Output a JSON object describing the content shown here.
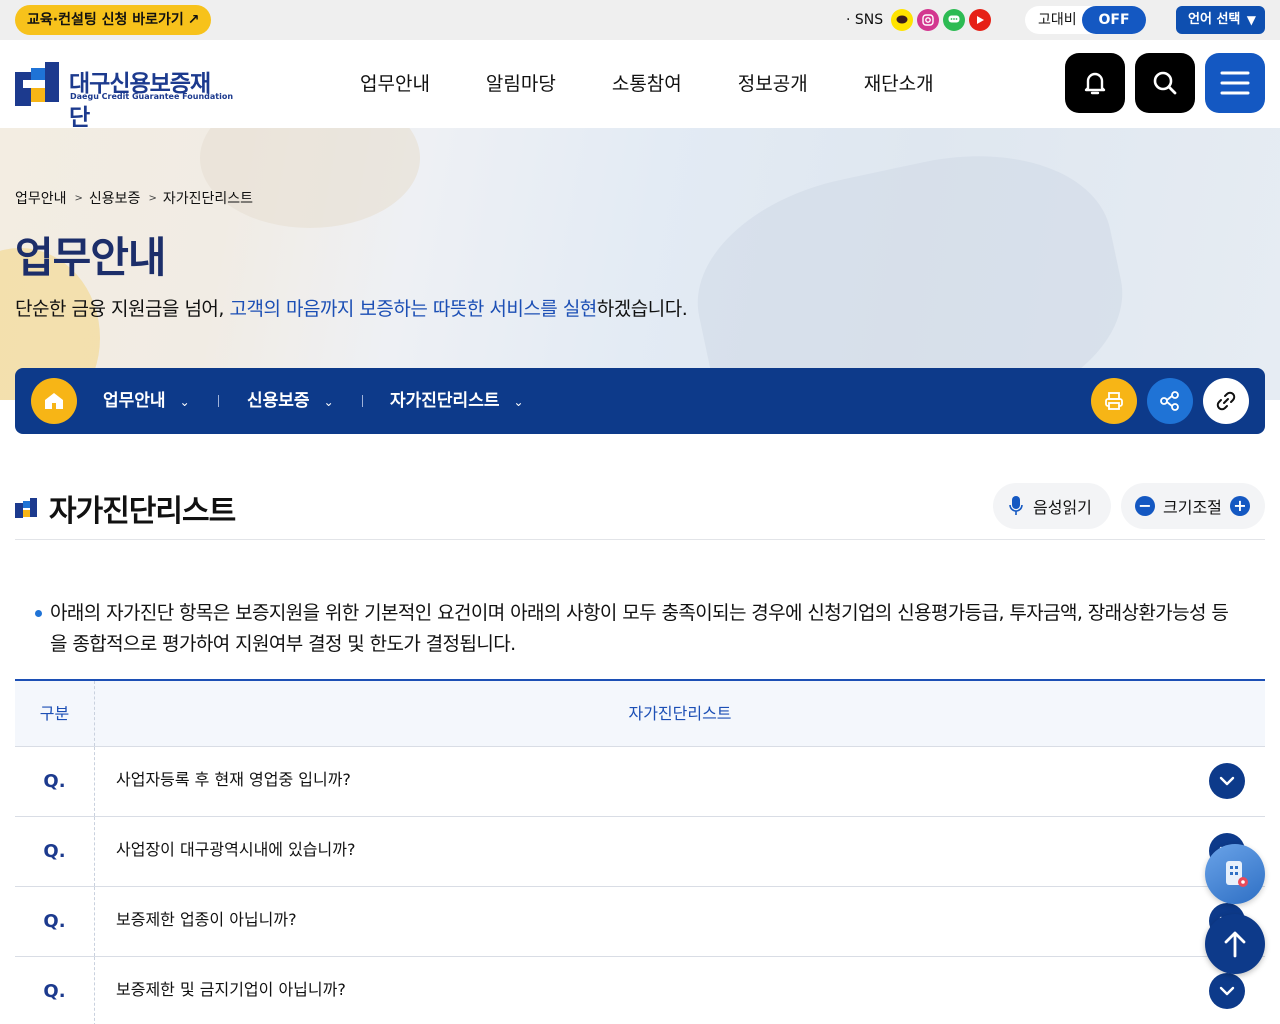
{
  "topbar": {
    "edu_link": "교육·컨설팅 신청 바로가기",
    "edu_arrow": "↗",
    "sns_label": "· SNS",
    "contrast_label": "고대비",
    "contrast_state": "OFF",
    "language": "언어 선택",
    "language_arrow": "▼"
  },
  "header": {
    "logo_ko": "대구신용보증재단",
    "logo_en": "Daegu Credit Guarantee Foundation",
    "nav": [
      "업무안내",
      "알림마당",
      "소통참여",
      "정보공개",
      "재단소개"
    ]
  },
  "visual": {
    "breadcrumb": [
      "업무안내",
      "신용보증",
      "자가진단리스트"
    ],
    "breadcrumb_sep": ">",
    "title": "업무안내",
    "subtitle_before": "단순한 금융 지원금을 넘어, ",
    "subtitle_highlight": "고객의 마음까지 보증하는 따뜻한 서비스를 실현",
    "subtitle_after": "하겠습니다."
  },
  "locbar": {
    "items": [
      "업무안내",
      "신용보증",
      "자가진단리스트"
    ],
    "chev": "⌄"
  },
  "content": {
    "title": "자가진단리스트",
    "read_label": "음성읽기",
    "size_label": "크기조절",
    "size_minus": "−",
    "size_plus": "+",
    "intro_line1": "아래의 자가진단 항목은 보증지원을 위한 기본적인 요건이며 아래의 사항이 모두 충족이되는 경우에 신청기업의 신용평가등급, 투자금액, 장래상환가능성 등",
    "intro_line2": "을 종합적으로 평가하여 지원여부 결정 및 한도가 결정됩니다."
  },
  "table": {
    "col1": "구분",
    "col2": "자가진단리스트",
    "rows": [
      {
        "q": "Q.",
        "text": "사업자등록 후 현재 영업중 입니까?"
      },
      {
        "q": "Q.",
        "text": "사업장이 대구광역시내에 있습니까?"
      },
      {
        "q": "Q.",
        "text": "보증제한 업종이 아닙니까?"
      },
      {
        "q": "Q.",
        "text": "보증제한 및 금지기업이 아닙니까?"
      }
    ]
  },
  "colors": {
    "brand_navy": "#0d3a8a",
    "brand_blue": "#1458c2",
    "accent_yellow": "#f7b516",
    "highlight_blue": "#1c4fb5"
  },
  "icons": [
    "kakao-icon",
    "instagram-icon",
    "kakaotalk-icon",
    "youtube-icon",
    "bell-icon",
    "search-icon",
    "menu-icon",
    "home-icon",
    "print-icon",
    "share-icon",
    "link-icon",
    "mic-icon",
    "chevron-down-icon",
    "building-icon",
    "arrow-up-icon"
  ]
}
